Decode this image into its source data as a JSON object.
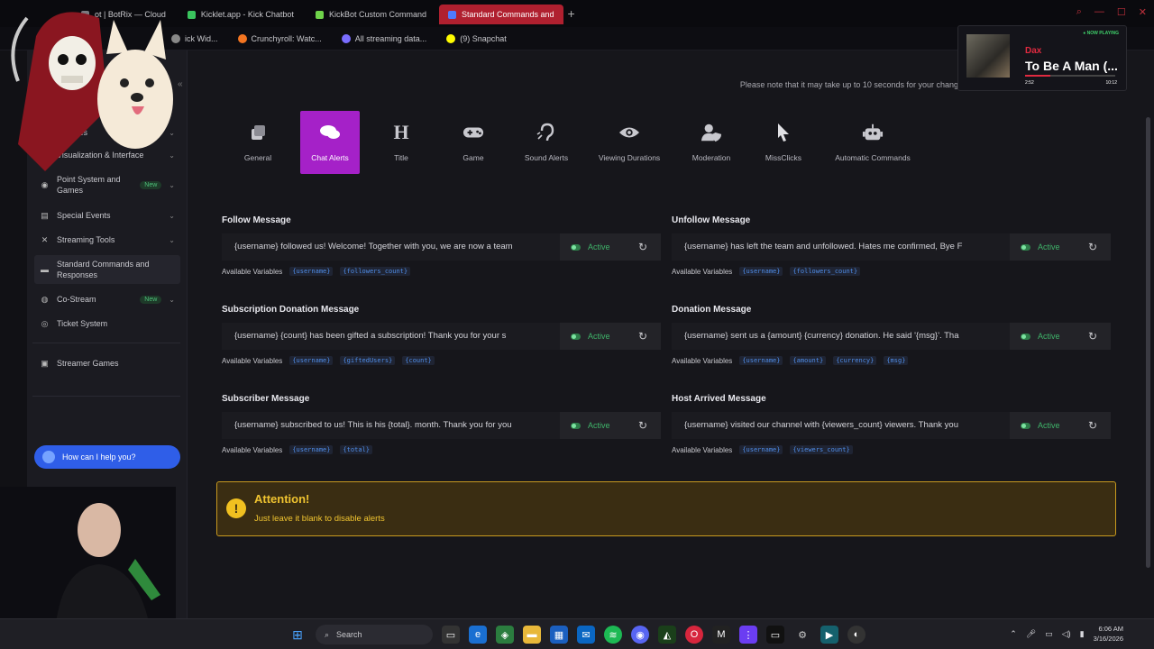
{
  "browser": {
    "tabs": [
      {
        "label": "ot | BotRix — Cloud",
        "color": "#7a7a80"
      },
      {
        "label": "Kicklet.app - Kick Chatbot",
        "color": "#3ac45e"
      },
      {
        "label": "KickBot Custom Command",
        "color": "#6fd34a"
      },
      {
        "label": "Standard Commands and",
        "color": "#4f7bff",
        "active": true
      }
    ],
    "bookmarks": [
      {
        "label": "ick Wid...",
        "color": "#888"
      },
      {
        "label": "Crunchyroll: Watc...",
        "color": "#f47521"
      },
      {
        "label": "All streaming data...",
        "color": "#7a6dff"
      },
      {
        "label": "(9) Snapchat",
        "color": "#fffc00"
      }
    ]
  },
  "sidebar": {
    "items": [
      {
        "label": "Modules",
        "icon": "grid-icon",
        "chev": true
      },
      {
        "label": "Visualization & Interface",
        "icon": "layers-icon",
        "chev": true
      },
      {
        "label": "Point System and Games",
        "icon": "coin-icon",
        "chev": true,
        "badge": "New"
      },
      {
        "label": "Special Events",
        "icon": "calendar-icon",
        "chev": true
      },
      {
        "label": "Streaming Tools",
        "icon": "tools-icon",
        "chev": true
      },
      {
        "label": "Standard Commands and Responses",
        "icon": "chat-icon",
        "active": true
      },
      {
        "label": "Co-Stream",
        "icon": "users-icon",
        "chev": true,
        "badge": "New"
      },
      {
        "label": "Ticket System",
        "icon": "ticket-icon"
      },
      {
        "label": "Streamer Games",
        "icon": "gamepad-icon"
      }
    ],
    "help_label": "How can I help you?"
  },
  "notice": "Please note that it may take up to 10 seconds for your change",
  "categories": [
    {
      "label": "General",
      "icon": "layers-icon"
    },
    {
      "label": "Chat Alerts",
      "icon": "comments-icon",
      "active": true
    },
    {
      "label": "Title",
      "icon": "heading-icon"
    },
    {
      "label": "Game",
      "icon": "gamepad-icon"
    },
    {
      "label": "Sound Alerts",
      "icon": "ear-icon"
    },
    {
      "label": "Viewing Durations",
      "icon": "eye-icon"
    },
    {
      "label": "Moderation",
      "icon": "user-shield-icon"
    },
    {
      "label": "MissClicks",
      "icon": "pointer-icon"
    },
    {
      "label": "Automatic Commands",
      "icon": "robot-icon"
    }
  ],
  "messages": [
    {
      "title": "Follow Message",
      "text": "{username} followed us! Welcome! Together with you, we are now a team",
      "status": "Active",
      "vars_label": "Available Variables",
      "vars": [
        "{username}",
        "{followers_count}"
      ]
    },
    {
      "title": "Unfollow Message",
      "text": "{username} has left the team and unfollowed. Hates me confirmed, Bye F",
      "status": "Active",
      "vars_label": "Available Variables",
      "vars": [
        "{username}",
        "{followers_count}"
      ]
    },
    {
      "title": "Subscription Donation Message",
      "text": "{username} {count} has been gifted a subscription!  Thank you for your s",
      "status": "Active",
      "vars_label": "Available Variables",
      "vars": [
        "{username}",
        "{giftedUsers}",
        "{count}"
      ]
    },
    {
      "title": "Donation Message",
      "text": "{username} sent us a {amount} {currency} donation. He said '{msg}'. Tha",
      "status": "Active",
      "vars_label": "Available Variables",
      "vars": [
        "{username}",
        "{amount}",
        "{currency}",
        "{msg}"
      ]
    },
    {
      "title": "Subscriber Message",
      "text": "{username} subscribed to us! This is his {total}. month. Thank you for you",
      "status": "Active",
      "vars_label": "Available Variables",
      "vars": [
        "{username}",
        "{total}"
      ]
    },
    {
      "title": "Host Arrived Message",
      "text": "{username} visited our channel with {viewers_count} viewers. Thank you",
      "status": "Active",
      "vars_label": "Available Variables",
      "vars": [
        "{username}",
        "{viewers_count}"
      ]
    }
  ],
  "attention": {
    "title": "Attention!",
    "text": "Just leave it blank to disable alerts"
  },
  "now_playing": {
    "tag": "● NOW PLAYING",
    "artist": "Dax",
    "song": "To Be A Man (...",
    "elapsed": "2:52",
    "duration": "10:12",
    "progress": 0.28
  },
  "taskbar": {
    "search": "Search",
    "time": "6:06 AM",
    "date": "3/16/2026"
  },
  "colors": {
    "accent": "#a521c8",
    "active": "#3fb46a",
    "warning": "#f0c430"
  }
}
